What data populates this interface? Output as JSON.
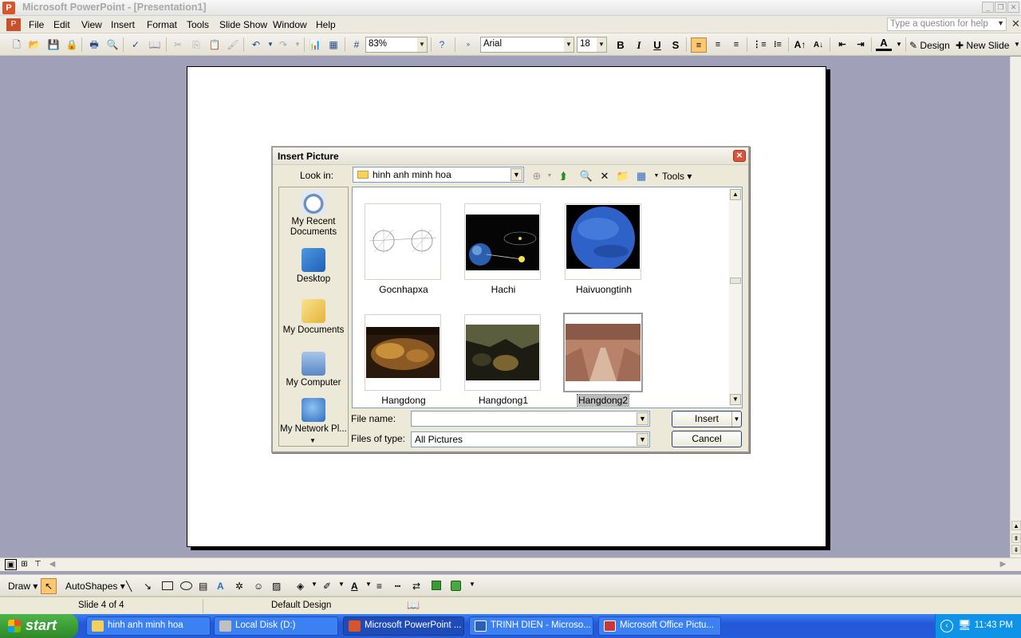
{
  "window": {
    "title": "Microsoft PowerPoint - [Presentation1]",
    "help_placeholder": "Type a question for help"
  },
  "menu": {
    "items": [
      {
        "label": "File"
      },
      {
        "label": "Edit"
      },
      {
        "label": "View"
      },
      {
        "label": "Insert"
      },
      {
        "label": "Format"
      },
      {
        "label": "Tools"
      },
      {
        "label": "Slide Show"
      },
      {
        "label": "Window"
      },
      {
        "label": "Help"
      }
    ]
  },
  "toolbar": {
    "zoom": "83%",
    "font": "Arial",
    "font_size": "18",
    "bold": "B",
    "italic": "I",
    "underline": "U",
    "shadow": "S",
    "design_label": "Design",
    "new_slide_label": "New Slide"
  },
  "dialog": {
    "title": "Insert Picture",
    "look_in_label": "Look in:",
    "look_in_value": "hinh anh minh hoa",
    "tools_label": "Tools",
    "places": [
      {
        "label": "My Recent Documents"
      },
      {
        "label": "Desktop"
      },
      {
        "label": "My Documents"
      },
      {
        "label": "My Computer"
      },
      {
        "label": "My Network Pl..."
      }
    ],
    "files": [
      {
        "name": "Gocnhapxa"
      },
      {
        "name": "Hachi"
      },
      {
        "name": "Haivuongtinh"
      },
      {
        "name": "Hangdong"
      },
      {
        "name": "Hangdong1"
      },
      {
        "name": "Hangdong2"
      }
    ],
    "file_name_label": "File name:",
    "file_name_value": "",
    "file_type_label": "Files of type:",
    "file_type_value": "All Pictures",
    "insert_label": "Insert",
    "cancel_label": "Cancel",
    "selected_file": "Hangdong2"
  },
  "drawbar": {
    "draw_label": "Draw",
    "autoshapes_label": "AutoShapes"
  },
  "status": {
    "slide": "Slide 4 of 4",
    "design": "Default Design"
  },
  "taskbar": {
    "start_label": "start",
    "tasks": [
      {
        "label": "hinh anh minh hoa"
      },
      {
        "label": "Local Disk (D:)"
      },
      {
        "label": "Microsoft PowerPoint ..."
      },
      {
        "label": "TRINH DIEN - Microso..."
      },
      {
        "label": "Microsoft Office Pictu..."
      }
    ],
    "clock": "11:43 PM"
  },
  "colors": {
    "workspace": "#a0a0b8",
    "dialog_bg": "#ece9d8",
    "taskbar": "#245cdc",
    "start_green": "#3a9a34"
  }
}
